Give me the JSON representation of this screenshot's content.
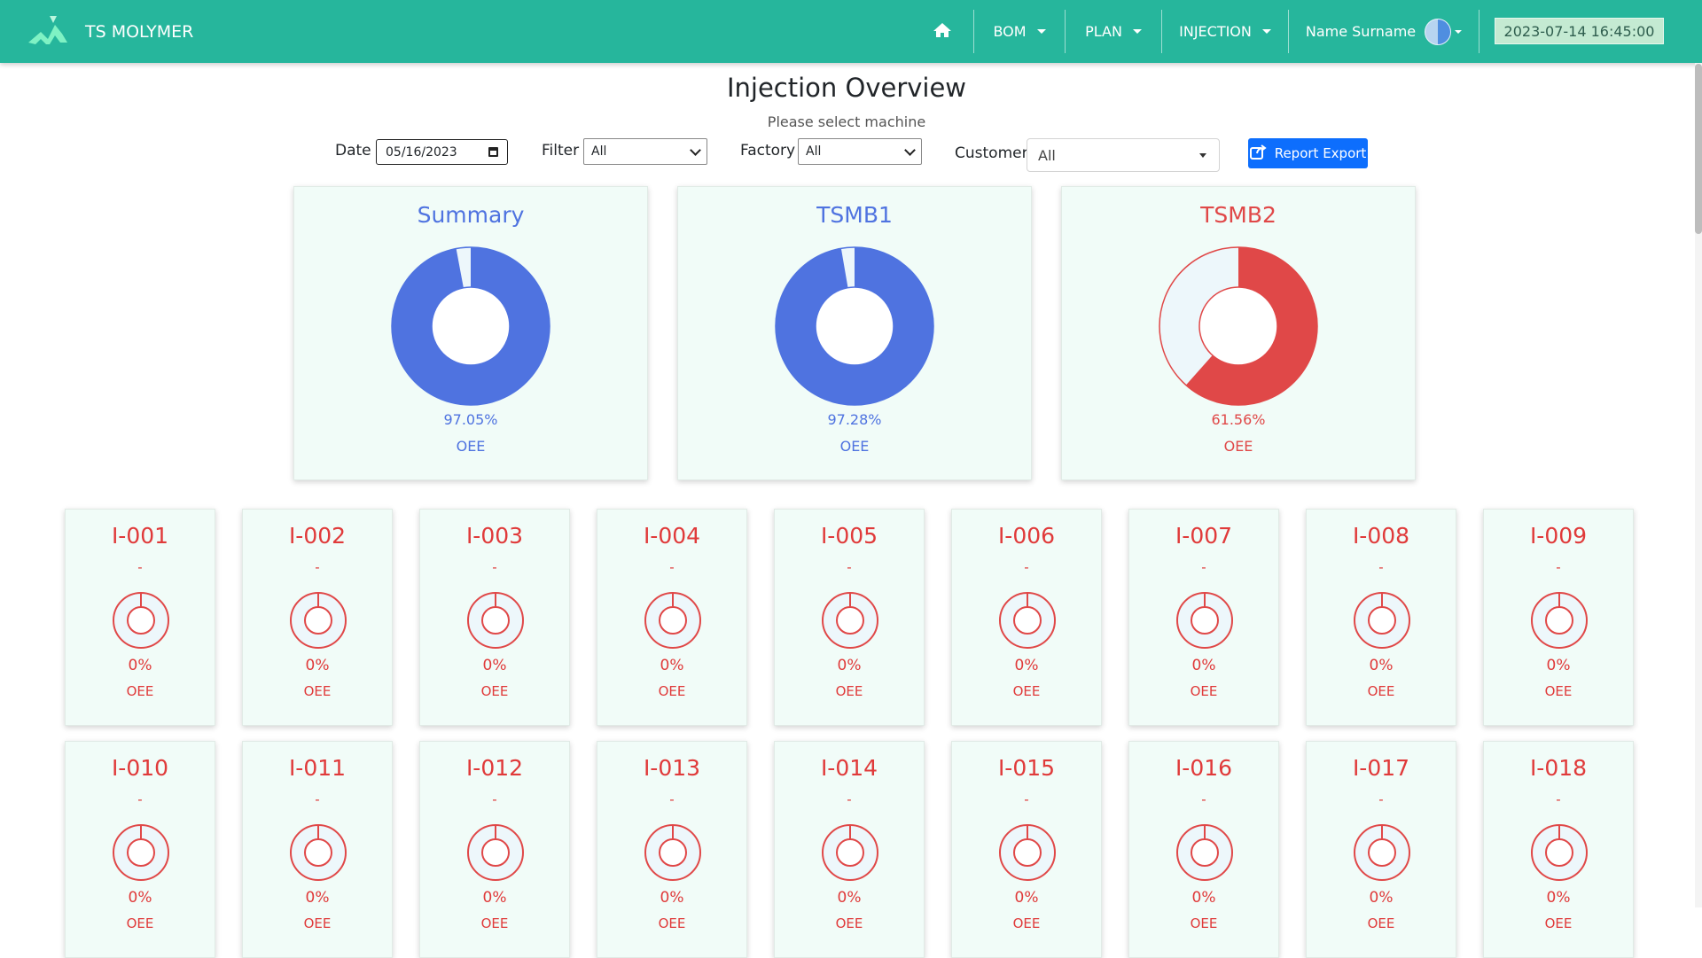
{
  "colors": {
    "nav": "#26b69c",
    "blue": "#4f73e0",
    "red": "#e04848",
    "ring_bg": "#edf7fb"
  },
  "nav": {
    "brand": "TS MOLYMER",
    "bom": "BOM",
    "plan": "PLAN",
    "injection": "INJECTION",
    "user": "Name Surname",
    "datetime": "2023-07-14 16:45:00"
  },
  "page": {
    "title": "Injection Overview",
    "subtitle": "Please select machine"
  },
  "filters": {
    "date_label": "Date",
    "date_value": "05/16/2023",
    "filter_label": "Filter",
    "filter_value": "All",
    "factory_label": "Factory",
    "factory_value": "All",
    "customer_label": "Customer",
    "customer_value": "All",
    "export_label": "Report Export"
  },
  "summary_cards": [
    {
      "title": "Summary",
      "value": "97.05%",
      "label": "OEE",
      "percent": 97.05,
      "color": "#4f73e0"
    },
    {
      "title": "TSMB1",
      "value": "97.28%",
      "label": "OEE",
      "percent": 97.28,
      "color": "#4f73e0"
    },
    {
      "title": "TSMB2",
      "value": "61.56%",
      "label": "OEE",
      "percent": 61.56,
      "color": "#e04848"
    }
  ],
  "machine_cards": [
    {
      "title": "I-001",
      "sub": "-",
      "value": "0%",
      "label": "OEE",
      "percent": 0
    },
    {
      "title": "I-002",
      "sub": "-",
      "value": "0%",
      "label": "OEE",
      "percent": 0
    },
    {
      "title": "I-003",
      "sub": "-",
      "value": "0%",
      "label": "OEE",
      "percent": 0
    },
    {
      "title": "I-004",
      "sub": "-",
      "value": "0%",
      "label": "OEE",
      "percent": 0
    },
    {
      "title": "I-005",
      "sub": "-",
      "value": "0%",
      "label": "OEE",
      "percent": 0
    },
    {
      "title": "I-006",
      "sub": "-",
      "value": "0%",
      "label": "OEE",
      "percent": 0
    },
    {
      "title": "I-007",
      "sub": "-",
      "value": "0%",
      "label": "OEE",
      "percent": 0
    },
    {
      "title": "I-008",
      "sub": "-",
      "value": "0%",
      "label": "OEE",
      "percent": 0
    },
    {
      "title": "I-009",
      "sub": "-",
      "value": "0%",
      "label": "OEE",
      "percent": 0
    },
    {
      "title": "I-010",
      "sub": "-",
      "value": "0%",
      "label": "OEE",
      "percent": 0
    },
    {
      "title": "I-011",
      "sub": "-",
      "value": "0%",
      "label": "OEE",
      "percent": 0
    },
    {
      "title": "I-012",
      "sub": "-",
      "value": "0%",
      "label": "OEE",
      "percent": 0
    },
    {
      "title": "I-013",
      "sub": "-",
      "value": "0%",
      "label": "OEE",
      "percent": 0
    },
    {
      "title": "I-014",
      "sub": "-",
      "value": "0%",
      "label": "OEE",
      "percent": 0
    },
    {
      "title": "I-015",
      "sub": "-",
      "value": "0%",
      "label": "OEE",
      "percent": 0
    },
    {
      "title": "I-016",
      "sub": "-",
      "value": "0%",
      "label": "OEE",
      "percent": 0
    },
    {
      "title": "I-017",
      "sub": "-",
      "value": "0%",
      "label": "OEE",
      "percent": 0
    },
    {
      "title": "I-018",
      "sub": "-",
      "value": "0%",
      "label": "OEE",
      "percent": 0
    }
  ]
}
